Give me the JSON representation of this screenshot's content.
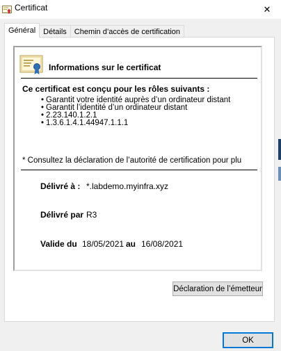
{
  "window": {
    "title": "Certificat",
    "close_glyph": "✕"
  },
  "tabs": [
    {
      "label": "Général",
      "active": true
    },
    {
      "label": "Détails",
      "active": false
    },
    {
      "label": "Chemin d’accès de certification",
      "active": false
    }
  ],
  "certificate": {
    "info_title": "Informations sur le certificat",
    "roles_title": "Ce certificat est conçu pour les rôles suivants :",
    "roles": [
      "Garantit votre identité auprès d’un ordinateur distant",
      "Garantit l’identité d’un ordinateur distant",
      "2.23.140.1.2.1",
      "1.3.6.1.4.1.44947.1.1.1"
    ],
    "note": "* Consultez la déclaration de l’autorité de certification pour plu",
    "issued_to_label": "Délivré à :",
    "issued_to_value": "*.labdemo.myinfra.xyz",
    "issued_by_label": "Délivré par",
    "issued_by_value": "R3",
    "valid_from_label": "Valide du",
    "valid_from_value": "18/05/2021",
    "valid_to_label": "au",
    "valid_to_value": "16/08/2021"
  },
  "buttons": {
    "issuer_statement": "Déclaration de l’émetteur",
    "ok": "OK"
  },
  "colors": {
    "accent": "#0078d7",
    "ribbon": "#2f6fb5",
    "right_edge_dark": "#1e3f66",
    "right_edge_light": "#6c8fb8"
  }
}
